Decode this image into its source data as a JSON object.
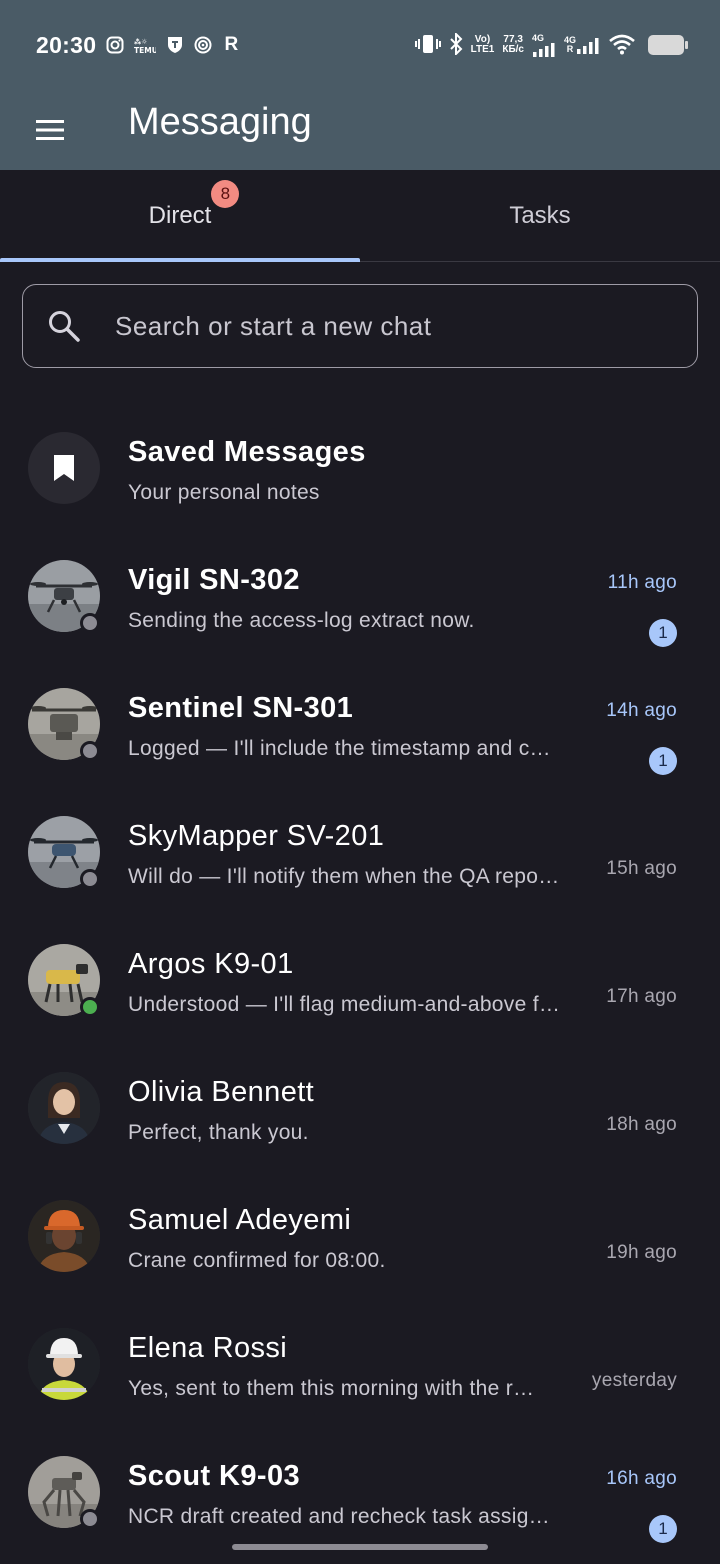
{
  "status_bar": {
    "time": "20:30",
    "left_icons": [
      "instagram-icon",
      "temu-icon",
      "shield-icon",
      "target-icon",
      "r-icon"
    ],
    "network_speed_value": "77,3",
    "network_speed_unit": "КБ/с",
    "volte_line1": "Vo)",
    "volte_line2": "LTE1",
    "net1": "4G",
    "net2": "4G",
    "net2_sub": "R"
  },
  "app_bar": {
    "title": "Messaging",
    "menu_icon": "menu-icon",
    "background": "#4a5b66"
  },
  "tabs": [
    {
      "label": "Direct",
      "badge": "8",
      "selected": true
    },
    {
      "label": "Tasks",
      "selected": false
    }
  ],
  "search": {
    "placeholder": "Search or start a new chat"
  },
  "saved": {
    "title": "Saved Messages",
    "subtitle": "Your personal notes",
    "icon": "bookmark-icon"
  },
  "chats": [
    {
      "name": "Vigil SN-302",
      "preview": "Sending the access-log extract now.",
      "time": "11h ago",
      "unread": "1",
      "bold": true,
      "online": false,
      "avatar": "drone"
    },
    {
      "name": "Sentinel SN-301",
      "preview": "Logged — I'll include the timestamp and c…",
      "time": "14h ago",
      "unread": "1",
      "bold": true,
      "online": false,
      "avatar": "drone-cargo"
    },
    {
      "name": "SkyMapper SV-201",
      "preview": "Will do — I'll notify them when the QA repo…",
      "time": "15h ago",
      "unread": null,
      "bold": false,
      "online": false,
      "avatar": "drone-blue"
    },
    {
      "name": "Argos K9-01",
      "preview": "Understood — I'll flag medium-and-above f…",
      "time": "17h ago",
      "unread": null,
      "bold": false,
      "online": true,
      "avatar": "robot-dog"
    },
    {
      "name": "Olivia Bennett",
      "preview": "Perfect, thank you.",
      "time": "18h ago",
      "unread": null,
      "bold": false,
      "online": null,
      "avatar": "woman"
    },
    {
      "name": "Samuel Adeyemi",
      "preview": "Crane confirmed for 08:00.",
      "time": "19h ago",
      "unread": null,
      "bold": false,
      "online": null,
      "avatar": "worker"
    },
    {
      "name": "Elena Rossi",
      "preview": "Yes, sent to them this morning with the r…",
      "time": "yesterday",
      "unread": null,
      "bold": false,
      "online": null,
      "avatar": "engineer"
    },
    {
      "name": "Scout K9-03",
      "preview": "NCR draft created and recheck task assig…",
      "time": "16h ago",
      "unread": "1",
      "bold": true,
      "online": false,
      "avatar": "robot-legs"
    }
  ],
  "colors": {
    "background": "#1b1a22",
    "accent": "#a8c7fa",
    "tab_badge": "#f28b82",
    "online": "#4caf50",
    "offline": "#8c8b93"
  }
}
